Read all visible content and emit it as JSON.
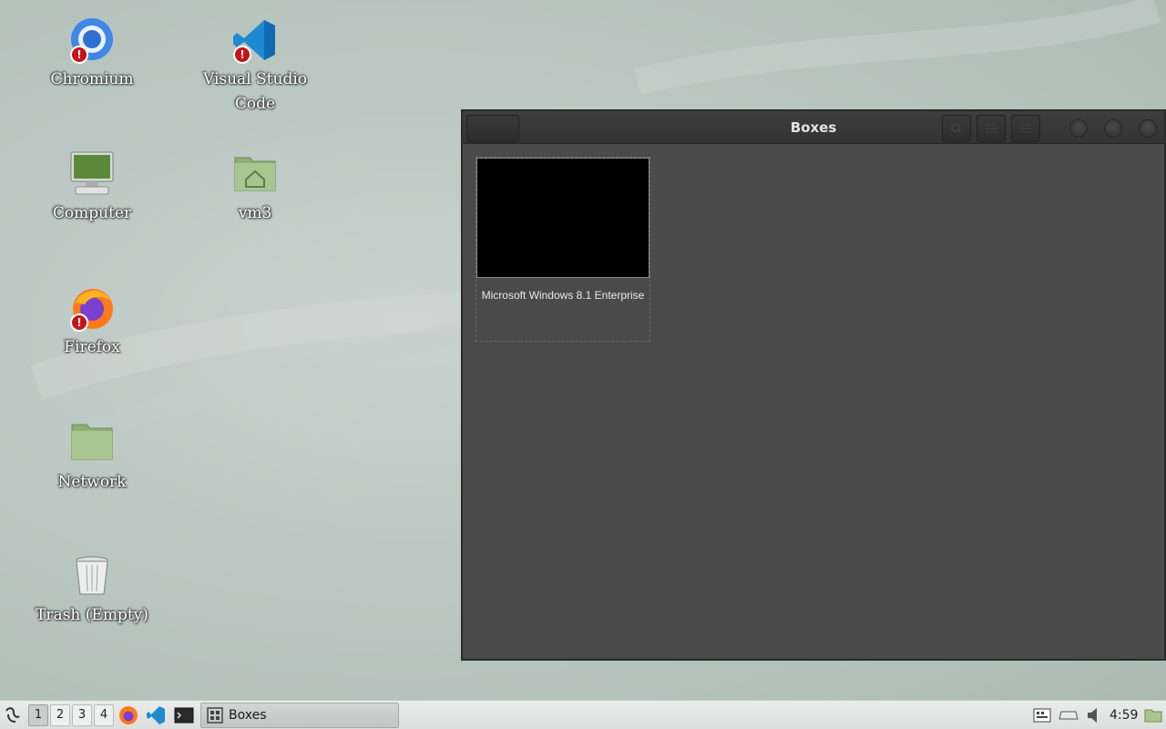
{
  "desktop": {
    "icons": {
      "chromium": "Chromium",
      "vscode": "Visual Studio Code",
      "computer": "Computer",
      "vm3": "vm3",
      "firefox": "Firefox",
      "network": "Network",
      "trash": "Trash (Empty)"
    },
    "warning_glyph": "!"
  },
  "window": {
    "title": "Boxes",
    "vms": [
      {
        "name": "Microsoft Windows 8.1 Enterprise"
      }
    ]
  },
  "taskbar": {
    "workspaces": [
      "1",
      "2",
      "3",
      "4"
    ],
    "active_workspace": "1",
    "tasks": [
      {
        "label": "Boxes"
      }
    ],
    "clock": "4:59"
  },
  "colors": {
    "desktop_bg": "#bcc8c3",
    "window_bg": "#4a4a4a",
    "titlebar": "#363636",
    "taskbar": "#e2e5e3"
  }
}
